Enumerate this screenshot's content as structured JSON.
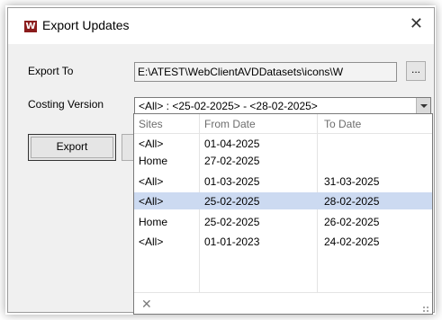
{
  "window": {
    "title": "Export Updates",
    "app_icon_glyph": "W",
    "close_glyph": "✕"
  },
  "form": {
    "export_to_label": "Export To",
    "export_to_value": "E:\\ATEST\\WebClientAVDDatasets\\icons\\W",
    "browse_label": "...",
    "costing_version_label": "Costing Version",
    "costing_version_value": "<All> : <25-02-2025> - <28-02-2025>",
    "export_button_label": "Export"
  },
  "dropdown": {
    "columns": [
      "Sites",
      "From Date",
      "To Date"
    ],
    "rows": [
      {
        "site": "<All>",
        "from": "01-04-2025",
        "to": ""
      },
      {
        "site": "Home",
        "from": "27-02-2025",
        "to": ""
      },
      {
        "site": "<All>",
        "from": "01-03-2025",
        "to": "31-03-2025"
      },
      {
        "site": "<All>",
        "from": "25-02-2025",
        "to": "28-02-2025",
        "selected": true
      },
      {
        "site": "Home",
        "from": "25-02-2025",
        "to": "26-02-2025"
      },
      {
        "site": "<All>",
        "from": "01-01-2023",
        "to": "24-02-2025"
      }
    ],
    "close_glyph": "✕"
  },
  "colors": {
    "selected_row": "#ccdaf1",
    "app_icon": "#8b1c1c"
  }
}
